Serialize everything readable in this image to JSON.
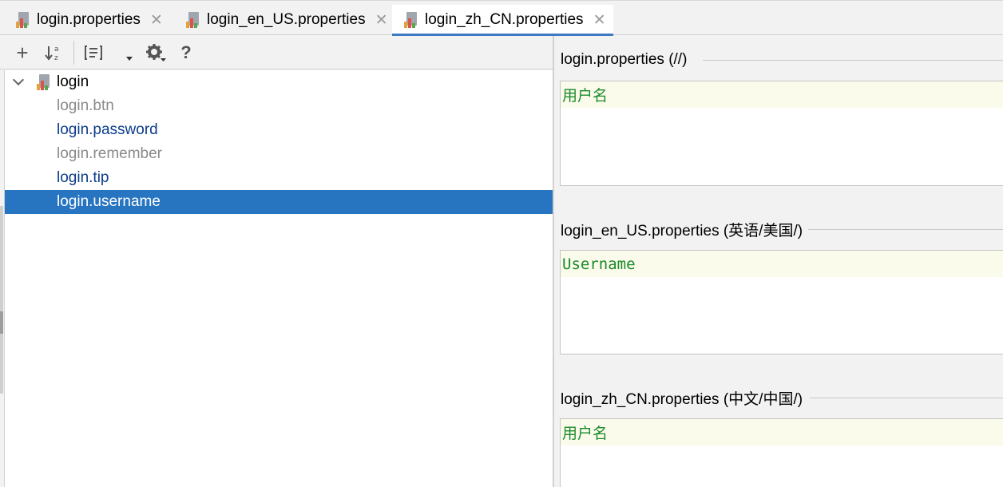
{
  "tabs": [
    {
      "label": "login.properties",
      "active": false
    },
    {
      "label": "login_en_US.properties",
      "active": false
    },
    {
      "label": "login_zh_CN.properties",
      "active": true
    }
  ],
  "toolbar": {
    "add": "+",
    "sort_icon": "sort-alpha-icon",
    "group_icon": "group-icon",
    "settings_icon": "gear-icon",
    "help": "?"
  },
  "tree": {
    "root": "login",
    "items": [
      {
        "label": "login.btn",
        "style": "muted"
      },
      {
        "label": "login.password",
        "style": "blue"
      },
      {
        "label": "login.remember",
        "style": "muted"
      },
      {
        "label": "login.tip",
        "style": "blue"
      },
      {
        "label": "login.username",
        "style": "selected"
      }
    ]
  },
  "editors": [
    {
      "title": "login.properties (//)",
      "value": "用户名"
    },
    {
      "title": "login_en_US.properties (英语/美国/)",
      "value": "Username"
    },
    {
      "title": "login_zh_CN.properties (中文/中国/)",
      "value": "用户名"
    }
  ],
  "colors": {
    "selection": "#2775c1",
    "active_tab_underline": "#3d7cc4",
    "value_text": "#1a8a2a",
    "editor_line_bg": "#fbfbeb"
  }
}
